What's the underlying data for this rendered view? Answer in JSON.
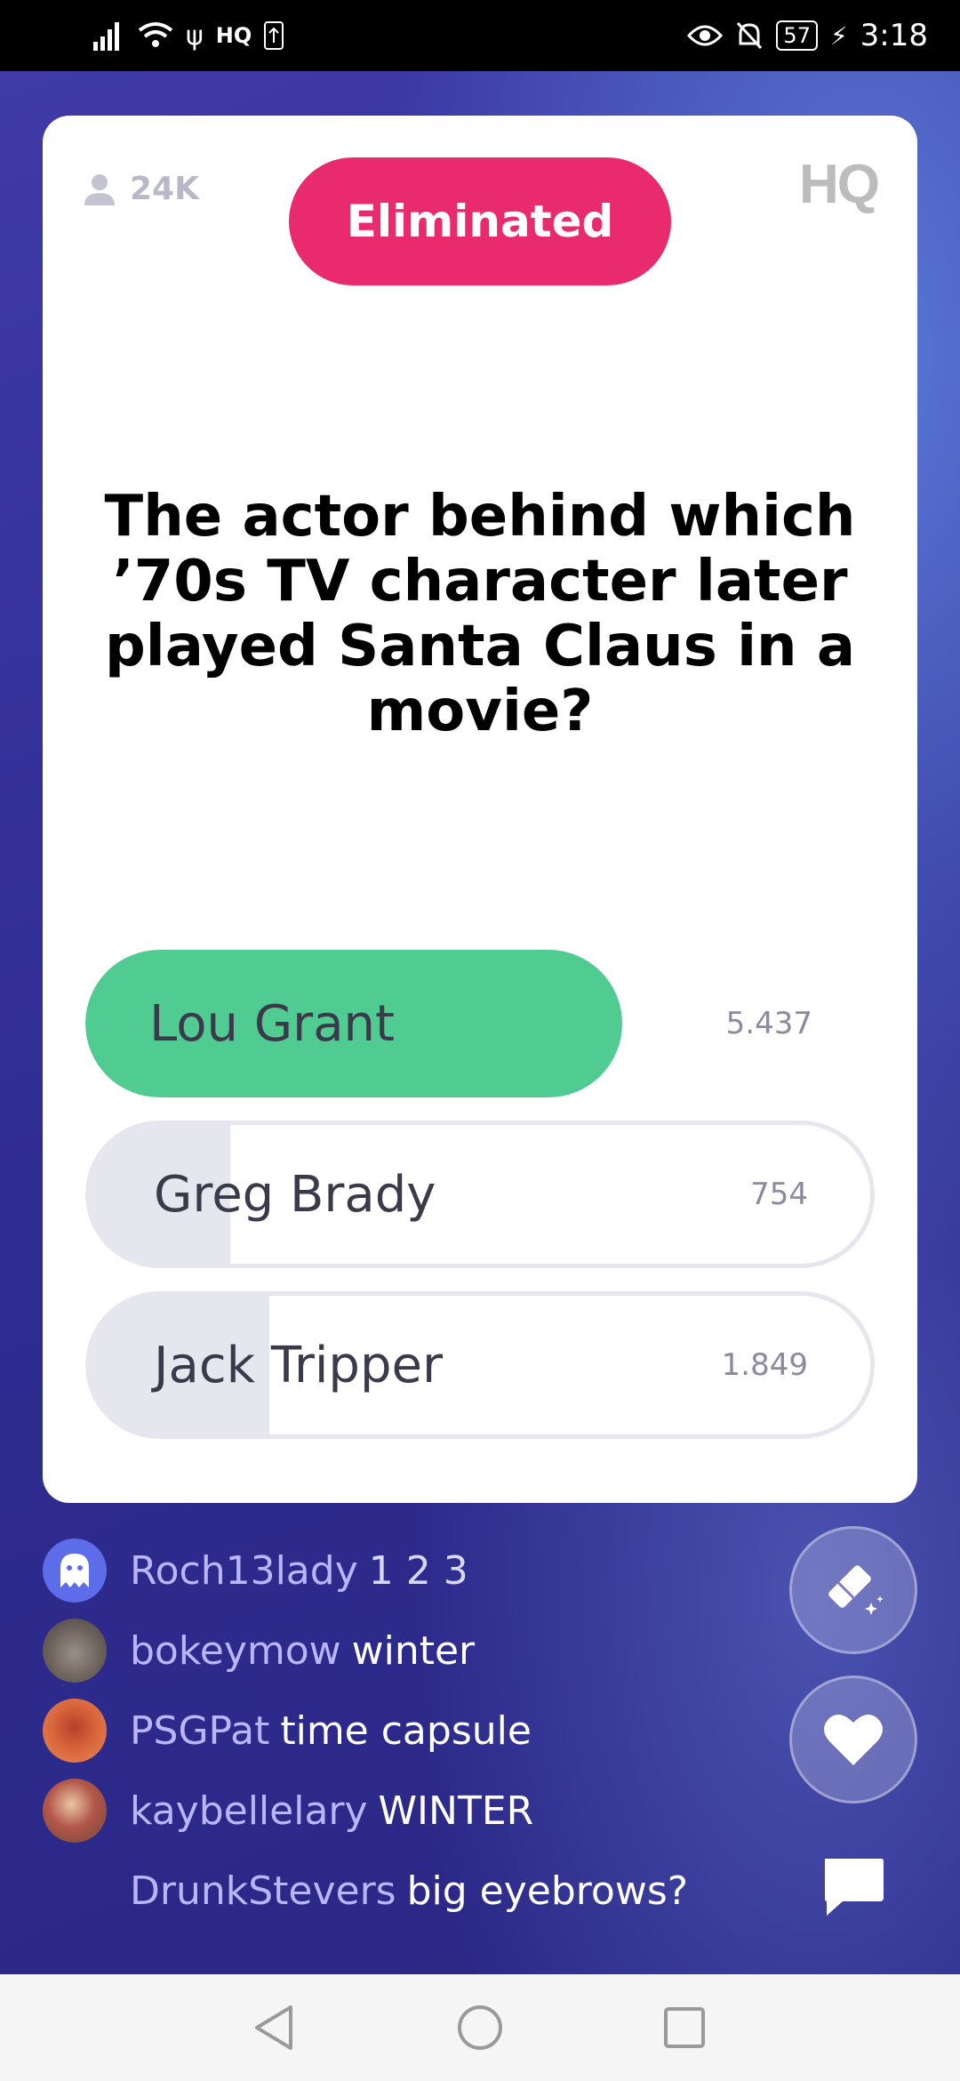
{
  "status_bar": {
    "network_label": "HQ",
    "battery": "57",
    "time": "3:18"
  },
  "game": {
    "viewers": "24K",
    "status_badge": "Eliminated",
    "logo": "HQ",
    "question": "The actor behind which ’70s TV character later played Santa Claus in a movie?",
    "answers": [
      {
        "label": "Lou Grant",
        "count": "5.437",
        "fill_fraction": 0.68,
        "correct": true
      },
      {
        "label": "Greg Brady",
        "count": "754",
        "fill_fraction": 0.18,
        "correct": false
      },
      {
        "label": "Jack Tripper",
        "count": "1.849",
        "fill_fraction": 0.23,
        "correct": false
      }
    ]
  },
  "chat": [
    {
      "user": "Roch13lady",
      "message": "1 2 3",
      "avatar": "ghost-avatar"
    },
    {
      "user": "bokeymow",
      "message": "winter",
      "avatar": "dog-avatar"
    },
    {
      "user": "PSGPat",
      "message": "time capsule",
      "avatar": "dog-avatar-orange"
    },
    {
      "user": "kaybellelary",
      "message": "WINTER",
      "avatar": "people-avatar"
    },
    {
      "user": "DrunkStevers",
      "message": "big eyebrows?",
      "avatar": "none"
    }
  ],
  "colors": {
    "accent_pink": "#e92a6c",
    "correct_green": "#50cc93",
    "background_purple": "#2e2a8a",
    "username": "#b9b6ff"
  },
  "icons": [
    "person-icon",
    "eraser-icon",
    "heart-icon",
    "chat-icon",
    "back-icon",
    "home-icon",
    "recents-icon"
  ]
}
